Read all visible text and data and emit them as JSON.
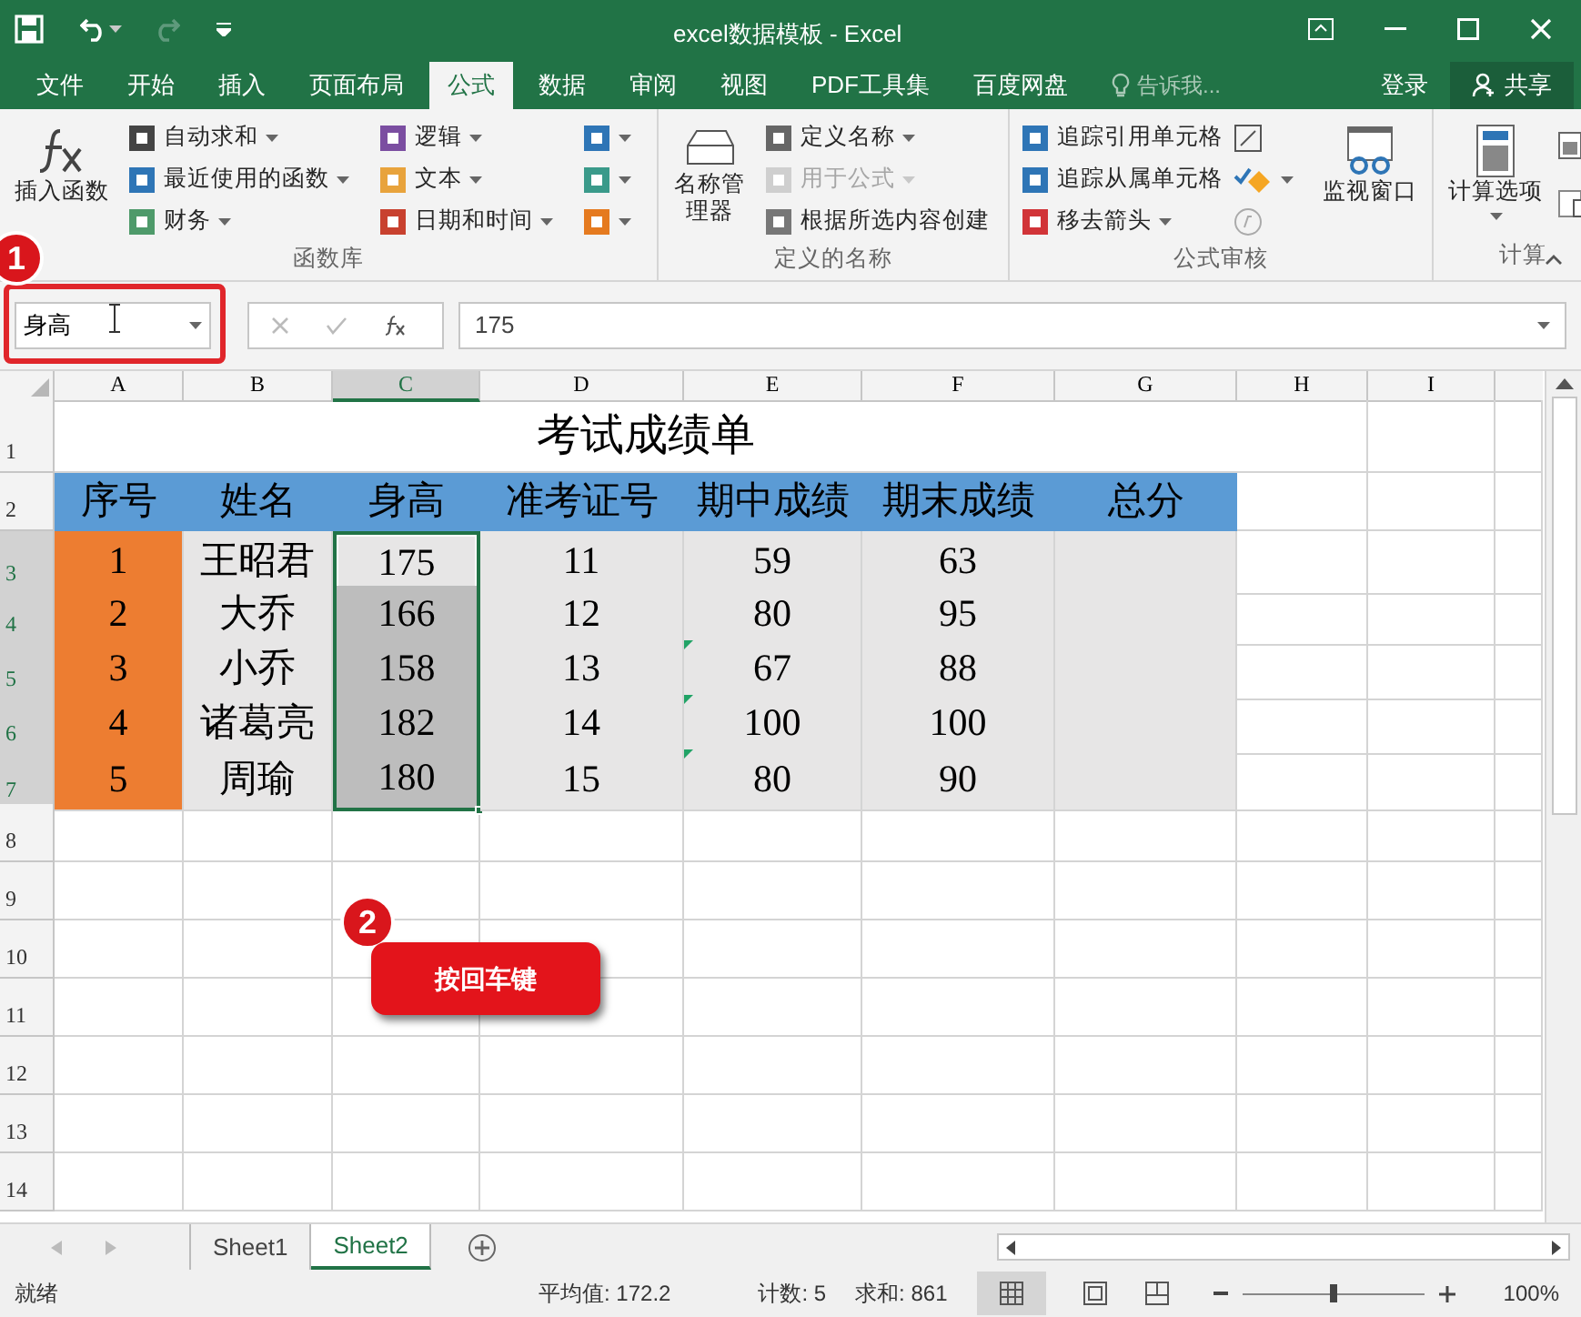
{
  "window": {
    "title": "excel数据模板 - Excel"
  },
  "ribbon_tabs": [
    {
      "label": "文件",
      "selected": false
    },
    {
      "label": "开始",
      "selected": false
    },
    {
      "label": "插入",
      "selected": false
    },
    {
      "label": "页面布局",
      "selected": false
    },
    {
      "label": "公式",
      "selected": true
    },
    {
      "label": "数据",
      "selected": false
    },
    {
      "label": "审阅",
      "selected": false
    },
    {
      "label": "视图",
      "selected": false
    },
    {
      "label": "PDF工具集",
      "selected": false
    },
    {
      "label": "百度网盘",
      "selected": false
    }
  ],
  "tell_me": {
    "placeholder": "告诉我..."
  },
  "account": {
    "sign_in": "登录",
    "share": "共享"
  },
  "ribbon_groups": [
    {
      "label": "函数库",
      "big": {
        "label": "插入函数"
      },
      "items": [
        {
          "label": "自动求和",
          "dropdown": true
        },
        {
          "label": "最近使用的函数",
          "dropdown": true
        },
        {
          "label": "财务",
          "dropdown": true
        },
        {
          "label": "逻辑",
          "dropdown": true
        },
        {
          "label": "文本",
          "dropdown": true
        },
        {
          "label": "日期和时间",
          "dropdown": true
        },
        {
          "dropdown": true
        },
        {
          "dropdown": true
        },
        {
          "dropdown": true
        }
      ]
    },
    {
      "label": "定义的名称",
      "big": {
        "label": "名称管理器"
      },
      "items": [
        {
          "label": "定义名称",
          "dropdown": true,
          "disabled": false
        },
        {
          "label": "用于公式",
          "dropdown": true,
          "disabled": true
        },
        {
          "label": "根据所选内容创建",
          "dropdown": false,
          "disabled": false
        }
      ]
    },
    {
      "label": "公式审核",
      "big": {
        "label": "监视窗口"
      },
      "items": [
        {
          "label": "追踪引用单元格",
          "dropdown": false
        },
        {
          "label": "追踪从属单元格",
          "dropdown": false
        },
        {
          "label": "移去箭头",
          "dropdown": true
        }
      ]
    },
    {
      "label": "计算",
      "big": {
        "label": "计算选项"
      }
    }
  ],
  "formula_bar": {
    "name_box": "身高",
    "value": "175"
  },
  "columns": [
    {
      "label": "A",
      "selected": false
    },
    {
      "label": "B",
      "selected": false
    },
    {
      "label": "C",
      "selected": true
    },
    {
      "label": "D",
      "selected": false
    },
    {
      "label": "E",
      "selected": false
    },
    {
      "label": "F",
      "selected": false
    },
    {
      "label": "G",
      "selected": false
    },
    {
      "label": "H",
      "selected": false
    },
    {
      "label": "I",
      "selected": false
    }
  ],
  "rows": [
    {
      "number": "1",
      "kind": "title",
      "selected": false,
      "title": "考试成绩单"
    },
    {
      "number": "2",
      "kind": "header",
      "selected": false,
      "cells": [
        {
          "text": "序号",
          "color": "#5b9bd5",
          "selected": false
        },
        {
          "text": "姓名",
          "color": "#5b9bd5",
          "selected": false
        },
        {
          "text": "身高",
          "color": "#5b9bd5",
          "selected": false
        },
        {
          "text": "准考证号",
          "color": "#5b9bd5",
          "selected": false
        },
        {
          "text": "期中成绩",
          "color": "#5b9bd5",
          "selected": false
        },
        {
          "text": "期末成绩",
          "color": "#5b9bd5",
          "selected": false
        },
        {
          "text": "总分",
          "color": "#5b9bd5",
          "selected": false
        }
      ]
    },
    {
      "number": "3",
      "kind": "data",
      "selected": true,
      "cells": [
        {
          "text": "1",
          "color": "#ed7d31",
          "selected": false
        },
        {
          "text": "王昭君",
          "color": "#e7e6e6",
          "selected": false
        },
        {
          "text": "175",
          "color": "#e7e6e6",
          "selected": true,
          "active": true
        },
        {
          "text": "11",
          "color": "#e7e6e6",
          "selected": false
        },
        {
          "text": "59",
          "color": "#e7e6e6",
          "selected": false
        },
        {
          "text": "63",
          "color": "#e7e6e6",
          "selected": false
        },
        {
          "text": "",
          "color": "#e7e6e6",
          "selected": false
        }
      ]
    },
    {
      "number": "4",
      "kind": "data",
      "selected": true,
      "cells": [
        {
          "text": "2",
          "color": "#ed7d31",
          "selected": false
        },
        {
          "text": "大乔",
          "color": "#e7e6e6",
          "selected": false
        },
        {
          "text": "166",
          "color": "#bdbdbd",
          "selected": true
        },
        {
          "text": "12",
          "color": "#e7e6e6",
          "selected": false
        },
        {
          "text": "80",
          "color": "#e7e6e6",
          "selected": false
        },
        {
          "text": "95",
          "color": "#e7e6e6",
          "selected": false
        },
        {
          "text": "",
          "color": "#e7e6e6",
          "selected": false
        }
      ]
    },
    {
      "number": "5",
      "kind": "data",
      "selected": true,
      "cells": [
        {
          "text": "3",
          "color": "#ed7d31",
          "selected": false
        },
        {
          "text": "小乔",
          "color": "#e7e6e6",
          "selected": false
        },
        {
          "text": "158",
          "color": "#bdbdbd",
          "selected": true
        },
        {
          "text": "13",
          "color": "#e7e6e6",
          "selected": false
        },
        {
          "text": "67",
          "color": "#e7e6e6",
          "selected": false,
          "flag": true
        },
        {
          "text": "88",
          "color": "#e7e6e6",
          "selected": false
        },
        {
          "text": "",
          "color": "#e7e6e6",
          "selected": false
        }
      ]
    },
    {
      "number": "6",
      "kind": "data",
      "selected": true,
      "cells": [
        {
          "text": "4",
          "color": "#ed7d31",
          "selected": false
        },
        {
          "text": "诸葛亮",
          "color": "#e7e6e6",
          "selected": false
        },
        {
          "text": "182",
          "color": "#bdbdbd",
          "selected": true
        },
        {
          "text": "14",
          "color": "#e7e6e6",
          "selected": false
        },
        {
          "text": "100",
          "color": "#e7e6e6",
          "selected": false,
          "flag": true
        },
        {
          "text": "100",
          "color": "#e7e6e6",
          "selected": false
        },
        {
          "text": "",
          "color": "#e7e6e6",
          "selected": false
        }
      ]
    },
    {
      "number": "7",
      "kind": "data",
      "selected": true,
      "cells": [
        {
          "text": "5",
          "color": "#ed7d31",
          "selected": false
        },
        {
          "text": "周瑜",
          "color": "#e7e6e6",
          "selected": false
        },
        {
          "text": "180",
          "color": "#bdbdbd",
          "selected": true
        },
        {
          "text": "15",
          "color": "#e7e6e6",
          "selected": false
        },
        {
          "text": "80",
          "color": "#e7e6e6",
          "selected": false,
          "flag": true
        },
        {
          "text": "90",
          "color": "#e7e6e6",
          "selected": false
        },
        {
          "text": "",
          "color": "#e7e6e6",
          "selected": false
        }
      ]
    },
    {
      "number": "8",
      "kind": "empty",
      "selected": false
    },
    {
      "number": "9",
      "kind": "empty",
      "selected": false
    },
    {
      "number": "10",
      "kind": "empty",
      "selected": false
    },
    {
      "number": "11",
      "kind": "empty",
      "selected": false
    },
    {
      "number": "12",
      "kind": "empty",
      "selected": false
    },
    {
      "number": "13",
      "kind": "empty",
      "selected": false
    },
    {
      "number": "14",
      "kind": "empty",
      "selected": false
    }
  ],
  "sheets": [
    {
      "label": "Sheet1",
      "selected": false
    },
    {
      "label": "Sheet2",
      "selected": true
    }
  ],
  "status_bar": {
    "ready": "就绪",
    "average": "平均值: 172.2",
    "count": "计数: 5",
    "sum": "求和: 861",
    "zoom": {
      "level": 0.5,
      "reading": "100%"
    }
  },
  "annotations": [
    {
      "number": "1"
    },
    {
      "number": "2",
      "note": "按回车键"
    }
  ]
}
